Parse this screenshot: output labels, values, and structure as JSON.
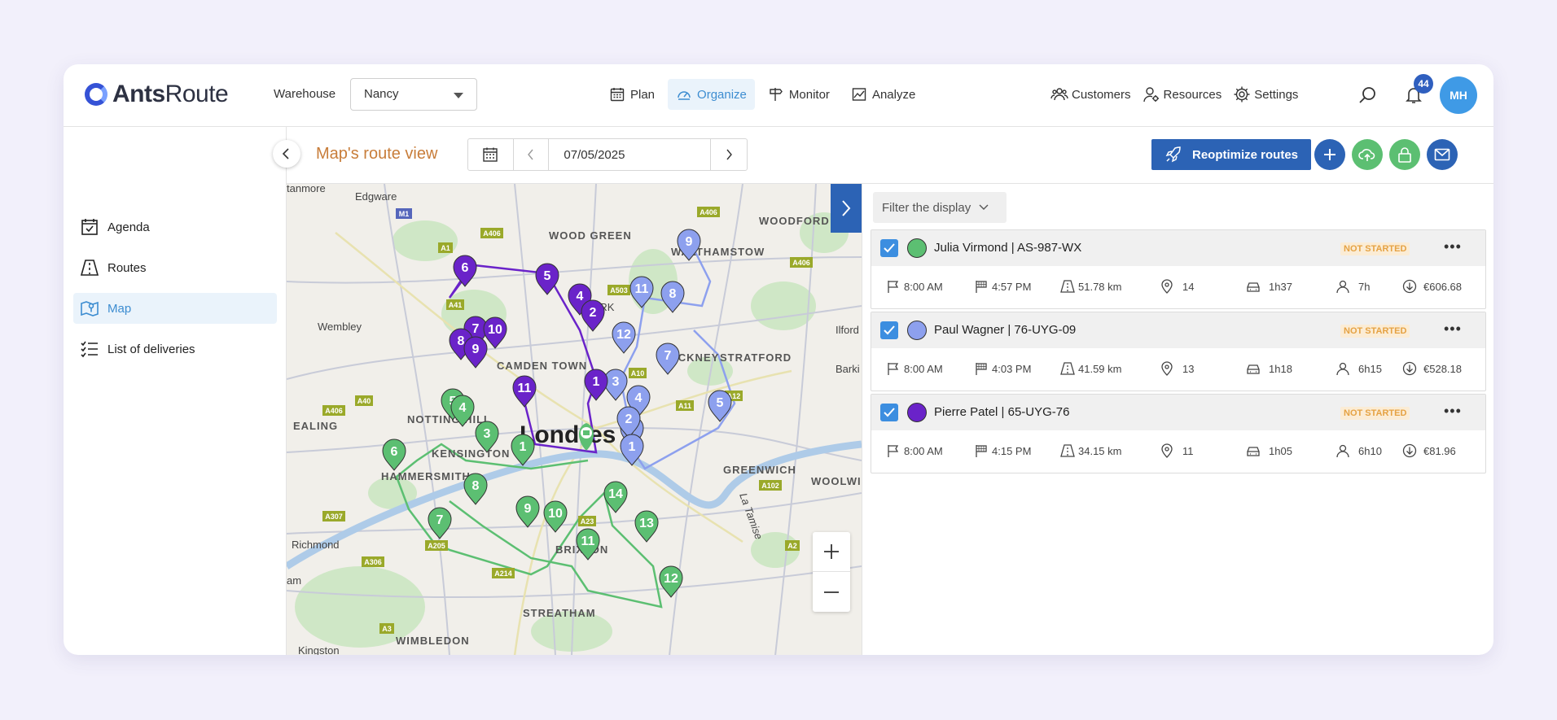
{
  "app": {
    "logo_bold": "Ants",
    "logo_light": "Route"
  },
  "topbar": {
    "warehouse_label": "Warehouse",
    "warehouse_value": "Nancy",
    "nav": [
      {
        "label": "Plan",
        "icon": "calendar-grid-icon"
      },
      {
        "label": "Organize",
        "icon": "gauge-icon",
        "active": true
      },
      {
        "label": "Monitor",
        "icon": "signpost-icon"
      },
      {
        "label": "Analyze",
        "icon": "chart-icon"
      }
    ],
    "right_nav": [
      {
        "label": "Customers",
        "icon": "users-icon"
      },
      {
        "label": "Resources",
        "icon": "user-gear-icon"
      },
      {
        "label": "Settings",
        "icon": "gear-icon"
      }
    ],
    "notifications_count": "44",
    "avatar_initials": "MH"
  },
  "sidebar": {
    "items": [
      {
        "label": "Agenda",
        "icon": "calendar-check-icon"
      },
      {
        "label": "Routes",
        "icon": "road-icon"
      },
      {
        "label": "Map",
        "icon": "map-icon",
        "active": true
      },
      {
        "label": "List of deliveries",
        "icon": "checklist-icon"
      }
    ]
  },
  "header": {
    "title": "Map's route view",
    "date": "07/05/2025",
    "reoptimize_label": "Reoptimize routes"
  },
  "colors": {
    "primary": "#2c63b5",
    "green_route": "#5cbf72",
    "blue_route": "#8da0ee",
    "purple_route": "#6a23c9",
    "status_text": "#e5a243"
  },
  "map": {
    "city_label": "Londres",
    "places": [
      "Edgware",
      "WOOD GREEN",
      "WALTHAMSTOW",
      "WOODFORD",
      "Wembley",
      "CAMDEN TOWN",
      "STRATFORD",
      "Ilford",
      "Barki",
      "EALING",
      "NOTTING HILL",
      "KENSINGTON",
      "HAMMERSMITH",
      "GREENWICH",
      "WOOLWI",
      "Richmond",
      "BRIXTON",
      "STREATHAM",
      "WIMBLEDON",
      "Kingston",
      "tanmore",
      "am",
      "HACKNEY",
      "PARK",
      "La Tamise"
    ],
    "roads": [
      "M1",
      "A406",
      "A1",
      "A41",
      "A406",
      "A503",
      "A406",
      "A40",
      "A406",
      "A10",
      "A12",
      "A11",
      "A102",
      "A307",
      "A3",
      "A306",
      "A214",
      "A23",
      "A2",
      "A205"
    ]
  },
  "filter_label": "Filter the display",
  "routes": [
    {
      "name": "Julia Virmond | AS-987-WX",
      "color": "#5cbf72",
      "status": "NOT STARTED",
      "start": "8:00 AM",
      "end": "4:57 PM",
      "distance": "51.78 km",
      "stops": "14",
      "drive_time": "1h37",
      "work_time": "7h",
      "cost": "€606.68"
    },
    {
      "name": "Paul Wagner | 76-UYG-09",
      "color": "#8da0ee",
      "status": "NOT STARTED",
      "start": "8:00 AM",
      "end": "4:03 PM",
      "distance": "41.59 km",
      "stops": "13",
      "drive_time": "1h18",
      "work_time": "6h15",
      "cost": "€528.18"
    },
    {
      "name": "Pierre Patel | 65-UYG-76",
      "color": "#6a23c9",
      "status": "NOT STARTED",
      "start": "8:00 AM",
      "end": "4:15 PM",
      "distance": "34.15 km",
      "stops": "11",
      "drive_time": "1h05",
      "work_time": "6h10",
      "cost": "€81.96"
    }
  ],
  "pins": {
    "purple": [
      "6",
      "5",
      "4",
      "2",
      "7",
      "10",
      "8",
      "9",
      "11",
      "1"
    ],
    "blue": [
      "9",
      "11",
      "8",
      "12",
      "7",
      "3",
      "4",
      "3",
      "2",
      "1",
      "5"
    ],
    "green": [
      "5",
      "4",
      "3",
      "1",
      "6",
      "8",
      "7",
      "9",
      "10",
      "14",
      "13",
      "11",
      "12"
    ]
  }
}
